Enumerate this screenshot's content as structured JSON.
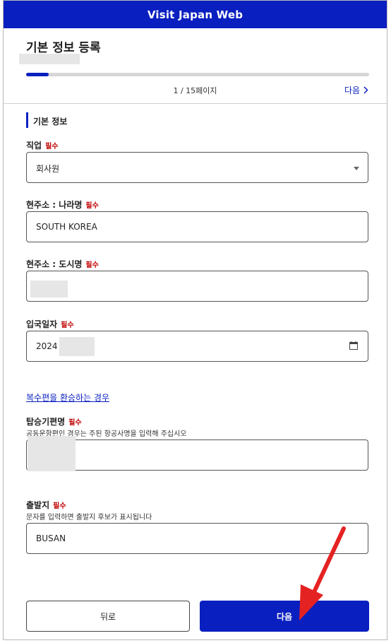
{
  "header": {
    "title": "Visit Japan Web"
  },
  "page": {
    "title": "기본 정보 등록",
    "progress": 0.066,
    "page_info": "1 / 15페이지",
    "next_link_label": "다음"
  },
  "section": {
    "title": "기본 정보"
  },
  "required_badge": "필수",
  "fields": {
    "occupation": {
      "label": "직업",
      "value": "회사원"
    },
    "country": {
      "label": "현주소 : 나라명",
      "value": "SOUTH KOREA"
    },
    "city": {
      "label": "현주소 : 도시명",
      "value": ""
    },
    "entry_date": {
      "label": "입국일자",
      "value": "2024"
    },
    "flight": {
      "label": "탑승기편명",
      "hint": "공동운항편인 경우는 주된 항공사명을 입력해 주십시오",
      "value": ""
    },
    "departure": {
      "label": "출발지",
      "hint": "문자를 입력하면 출발지 후보가 표시됩니다",
      "value": "BUSAN"
    }
  },
  "multi_flight_link": "복수편을 환승하는 경우",
  "buttons": {
    "back": "뒤로",
    "next": "다음"
  },
  "colors": {
    "primary": "#0a1fc0",
    "required": "#c00000",
    "annotation_arrow": "#e52222"
  }
}
